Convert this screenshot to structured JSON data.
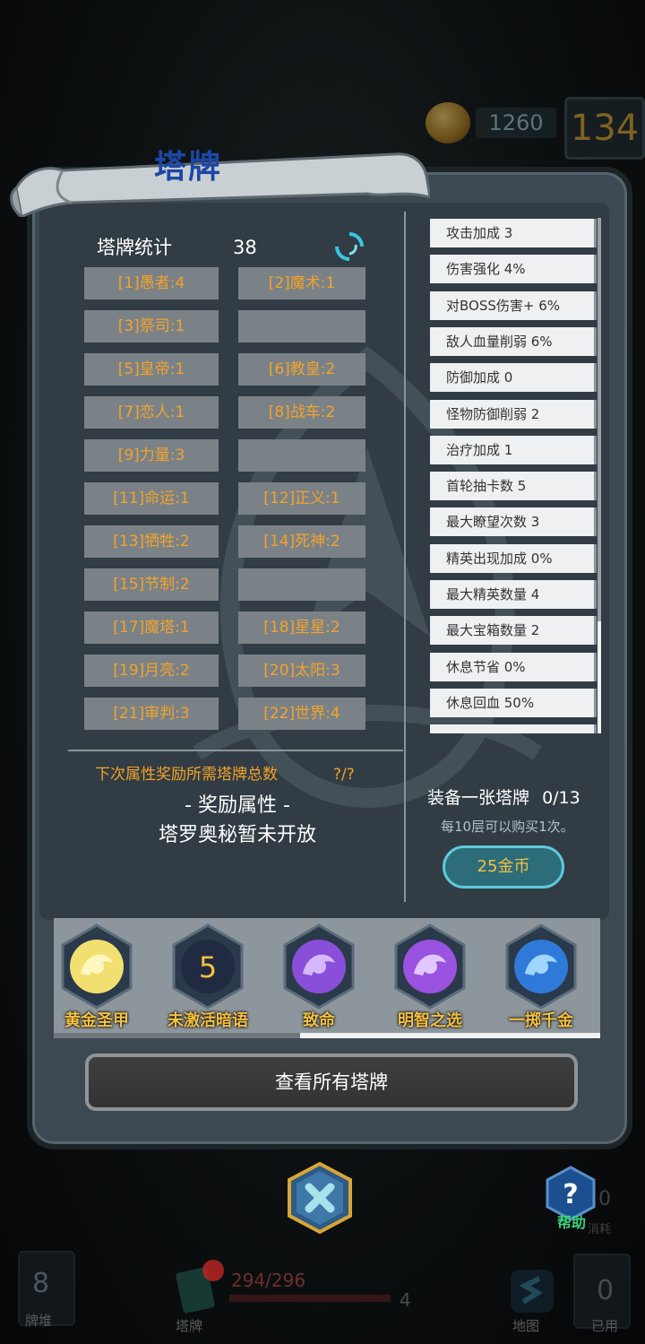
{
  "hud": {
    "coins": "1260",
    "floor": "134"
  },
  "panel": {
    "title": "塔牌"
  },
  "stats": {
    "title": "塔牌统计",
    "total": "38",
    "cards": [
      [
        "[1]愚者:4",
        "[2]魔术:1"
      ],
      [
        "[3]祭司:1",
        ""
      ],
      [
        "[5]皇帝:1",
        "[6]教皇:2"
      ],
      [
        "[7]恋人:1",
        "[8]战车:2"
      ],
      [
        "[9]力量:3",
        ""
      ],
      [
        "[11]命运:1",
        "[12]正义:1"
      ],
      [
        "[13]牺牲:2",
        "[14]死神:2"
      ],
      [
        "[15]节制:2",
        ""
      ],
      [
        "[17]魔塔:1",
        "[18]星星:2"
      ],
      [
        "[19]月亮:2",
        "[20]太阳:3"
      ],
      [
        "[21]审判:3",
        "[22]世界:4"
      ]
    ]
  },
  "attributes": [
    "攻击加成 3",
    "伤害强化 4%",
    "对BOSS伤害+ 6%",
    "敌人血量削弱 6%",
    "防御加成 0",
    "怪物防御削弱 2",
    "治疗加成 1",
    "首轮抽卡数 5",
    "最大瞭望次数 3",
    "精英出现加成 0%",
    "最大精英数量 4",
    "最大宝箱数量 2",
    "休息节省 0%",
    "休息回血 50%"
  ],
  "reward": {
    "next_label": "下次属性奖励所需塔牌总数",
    "next_value": "?/?",
    "attr_label": "- 奖励属性 -",
    "closed_text": "塔罗奥秘暂未开放"
  },
  "shop": {
    "equip_label": "装备一张塔牌",
    "equip_count": "0/13",
    "note": "每10层可以购买1次。",
    "button": "25金币"
  },
  "skills": [
    {
      "label": "黄金圣甲",
      "icon": "golden-swirl-icon"
    },
    {
      "label": "未激活暗语",
      "icon": "number-5-icon",
      "number": "5"
    },
    {
      "label": "致命",
      "icon": "purple-eye-icon"
    },
    {
      "label": "明智之选",
      "icon": "purple-flame-icon"
    },
    {
      "label": "一掷千金",
      "icon": "blue-lightning-icon"
    }
  ],
  "skill_scroll_progress": 0.45,
  "view_all_button": "查看所有塔牌",
  "help_label": "帮助",
  "consume": {
    "label": "消耗",
    "count": "0"
  },
  "nav": {
    "deck_count": "8",
    "deck_label": "牌堆",
    "tarot_label": "塔牌",
    "hp": "294/296",
    "shield": "4",
    "map_label": "地图",
    "used_count": "0",
    "used_label": "已用"
  },
  "colors": {
    "accent_orange": "#f3a32a",
    "gold": "#f3c042",
    "button_teal": "#2d6c79",
    "title_blue": "#1d47a6"
  }
}
